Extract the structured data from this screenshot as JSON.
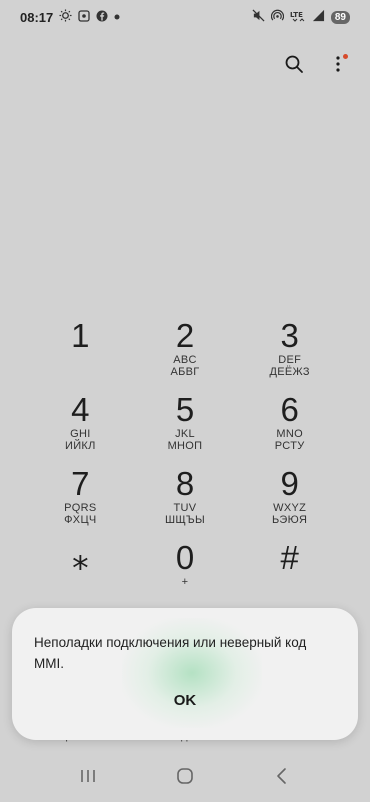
{
  "status_bar": {
    "time": "08:17",
    "battery": "89",
    "left_icons": [
      "brightness-icon",
      "screenshot-icon",
      "facebook-icon",
      "dot-icon"
    ],
    "right_icons": [
      "mute-icon",
      "hotspot-icon",
      "lte-icon",
      "signal-icon"
    ]
  },
  "top_actions": {
    "search_icon": "search-icon",
    "more_icon": "more-vertical-icon",
    "more_badge_color": "#d64a2b"
  },
  "keypad": [
    {
      "digit": "1",
      "letters": "",
      "letters2": ""
    },
    {
      "digit": "2",
      "letters": "ABC",
      "letters2": "АБВГ"
    },
    {
      "digit": "3",
      "letters": "DEF",
      "letters2": "ДЕЁЖЗ"
    },
    {
      "digit": "4",
      "letters": "GHI",
      "letters2": "ИЙКЛ"
    },
    {
      "digit": "5",
      "letters": "JKL",
      "letters2": "МНОП"
    },
    {
      "digit": "6",
      "letters": "MNO",
      "letters2": "РСТУ"
    },
    {
      "digit": "7",
      "letters": "PQRS",
      "letters2": "ФХЦЧ"
    },
    {
      "digit": "8",
      "letters": "TUV",
      "letters2": "ШЩЪЫ"
    },
    {
      "digit": "9",
      "letters": "WXYZ",
      "letters2": "ЬЭЮЯ"
    },
    {
      "digit": "⁎",
      "letters": "",
      "letters2": ""
    },
    {
      "digit": "0",
      "letters": "+",
      "letters2": ""
    },
    {
      "digit": "#",
      "letters": "",
      "letters2": ""
    }
  ],
  "bottom_tabs": [
    "Набор",
    "Последние",
    "Контакты"
  ],
  "dialog": {
    "message": "Неполадки подключения или неверный код MMI.",
    "ok_label": "OK"
  },
  "nav_bar": {
    "recents_icon": "recents-icon",
    "home_icon": "home-icon",
    "back_icon": "back-icon"
  }
}
